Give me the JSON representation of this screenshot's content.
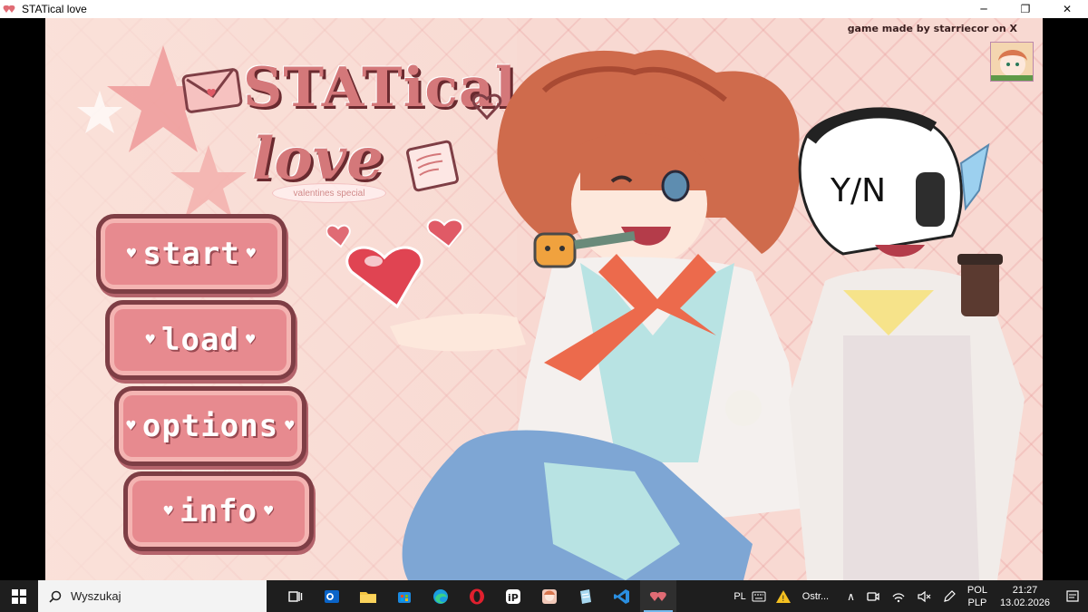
{
  "window": {
    "title": "STATical love",
    "controls": {
      "minimize": "─",
      "maximize": "❐",
      "close": "✕"
    }
  },
  "game": {
    "credit": "game made by starriecor on X",
    "logo": {
      "line1": "STATical",
      "line2": "love",
      "tagline": "valentines special"
    },
    "menu": [
      {
        "id": "start",
        "label": "start"
      },
      {
        "id": "load",
        "label": "load"
      },
      {
        "id": "options",
        "label": "options"
      },
      {
        "id": "info",
        "label": "info"
      }
    ],
    "character_label": "Y/N",
    "colors": {
      "background": "#f8d9d2",
      "button": "#e78a8f",
      "button_border": "#7e3e45",
      "logo": "#d4787a"
    }
  },
  "taskbar": {
    "search_placeholder": "Wyszukaj",
    "apps": [
      "task-view-icon",
      "outlook-icon",
      "file-explorer-icon",
      "store-icon",
      "edge-icon",
      "opera-icon",
      "ibis-paint-icon",
      "character-app-icon",
      "notes-app-icon",
      "vscode-icon",
      "statical-love-icon"
    ],
    "tray": {
      "keyboard": "PL",
      "notification": "Ostr...",
      "language_top": "POL",
      "language_bottom": "PLP",
      "time": "21:27",
      "date": "13.02.2026"
    }
  }
}
